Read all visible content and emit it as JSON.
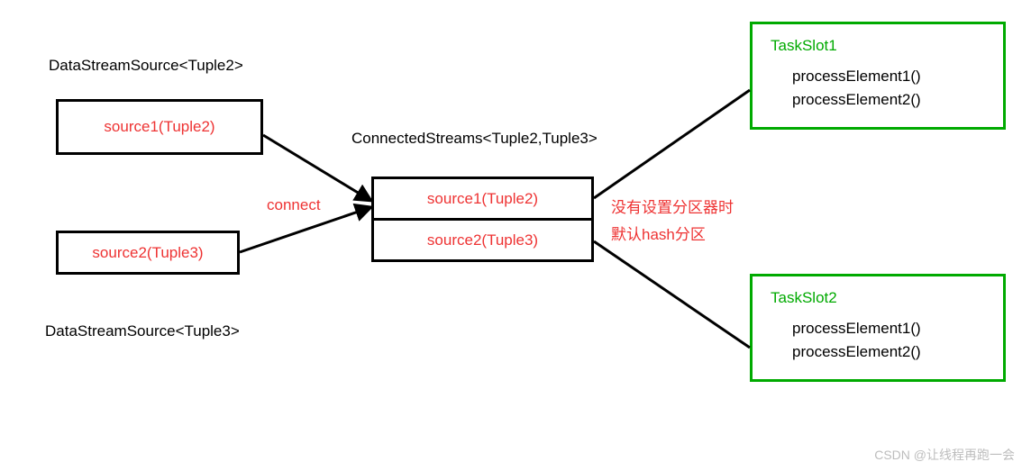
{
  "labels": {
    "header1": "DataStreamSource<Tuple2>",
    "header2": "DataStreamSource<Tuple3>",
    "connected": "ConnectedStreams<Tuple2,Tuple3>",
    "connect": "connect",
    "note1": "没有设置分区器时",
    "note2": "默认hash分区",
    "watermark": "CSDN @让线程再跑一会"
  },
  "sources": {
    "s1": "source1(Tuple2)",
    "s2": "source2(Tuple3)"
  },
  "conn": {
    "c1": "source1(Tuple2)",
    "c2": "source2(Tuple3)"
  },
  "slots": {
    "slot1_title": "TaskSlot1",
    "slot2_title": "TaskSlot2",
    "p1": "processElement1()",
    "p2": "processElement2()"
  }
}
